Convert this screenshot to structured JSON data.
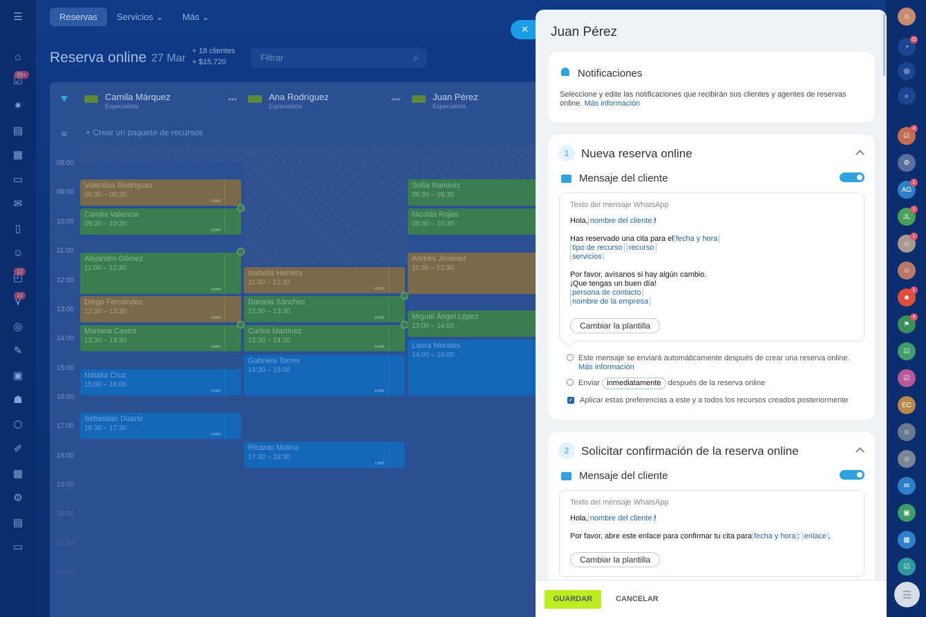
{
  "nav_left": {
    "badges": [
      "99+",
      "12",
      "14"
    ]
  },
  "topbar": {
    "tabs": [
      {
        "label": "Reservas"
      },
      {
        "label": "Servicios ⌄"
      },
      {
        "label": "Más ⌄"
      }
    ]
  },
  "header": {
    "title": "Reserva online",
    "date": "27 Mar",
    "clients": "+ 18 clientes",
    "revenue": "+ $15,720",
    "filter_placeholder": "Filtrar"
  },
  "calendar": {
    "columns": [
      {
        "name": "Camila Márquez",
        "role": "Especialista"
      },
      {
        "name": "Ana Rodríguez",
        "role": "Especialista"
      },
      {
        "name": "Juan Pérez",
        "role": "Especialista"
      }
    ],
    "create_package": "+ Crear un paquete de recursos",
    "hours": [
      "08:00",
      "09:00",
      "10:00",
      "11:00",
      "12:00",
      "13:00",
      "14:00",
      "15:00",
      "16:00",
      "17:00",
      "18:00",
      "19:00",
      "20:00",
      "21:00",
      "22:00"
    ],
    "events": [
      {
        "name": "Valentina Rodríguez",
        "time": "08:30 – 09:30",
        "crm": "CRM"
      },
      {
        "name": "Camila Valencia",
        "time": "09:30 – 10:30",
        "crm": "CRM"
      },
      {
        "name": "Alejandro Gómez",
        "time": "11:00 – 12:30",
        "crm": "CRM"
      },
      {
        "name": "Diego Fernández",
        "time": "12:30 – 13:30",
        "crm": "CRM"
      },
      {
        "name": "Mariana Castro",
        "time": "13:30 – 14:30",
        "crm": "CRM"
      },
      {
        "name": "Natalia Cruz",
        "time": "15:00 – 16:00",
        "crm": "CRM"
      },
      {
        "name": "Sebastián Duarte",
        "time": "16:30 – 17:30",
        "crm": "CRM"
      },
      {
        "name": "Isabella Herrera",
        "time": "11:30 – 12:30",
        "crm": "CRM"
      },
      {
        "name": "Daniela Sánchez",
        "time": "12:30 – 13:30",
        "crm": "CRM"
      },
      {
        "name": "Carlos Martínez",
        "time": "13:30 – 14:30",
        "crm": "CRM"
      },
      {
        "name": "Gabriela Torres",
        "time": "14:30 – 16:00",
        "crm": "CRM"
      },
      {
        "name": "Ricardo Molina",
        "time": "17:30 – 18:30",
        "crm": "CRM"
      },
      {
        "name": "Sofía Ramírez",
        "time": "08:30 – 09:30",
        "crm": ""
      },
      {
        "name": "Nicolás Rojas",
        "time": "09:30 – 10:30",
        "crm": ""
      },
      {
        "name": "Andrés Jiménez",
        "time": "11:00 – 12:30",
        "crm": ""
      },
      {
        "name": "Miguel Ángel López",
        "time": "13:00 – 14:00",
        "crm": ""
      },
      {
        "name": "Laura Morales",
        "time": "14:00 – 16:00",
        "crm": ""
      }
    ]
  },
  "panel": {
    "title": "Juan Pérez",
    "close": "✕",
    "notif": {
      "title": "Notificaciones",
      "desc": "Seleccione y edite las notificaciones que recibirán sus clientes y agentes de reservas online.",
      "link": "Más información"
    },
    "sec1": {
      "num": "1",
      "title": "Nueva reserva online",
      "msg_title": "Mensaje del cliente",
      "box_header": "Texto del mensaje WhatsApp",
      "hola": "Hola,",
      "tag_name": "nombre del cliente",
      "excl": "!",
      "l2a": "Has reservado una cita para el",
      "tag_fecha": "fecha y hora",
      "tag_tipo": "tipo de recurso",
      "tag_recurso": "recurso",
      "tag_serv": "servicios",
      "l4": "Por favor, avísanos si hay algún cambio.",
      "l5": "¡Que tengas un buen día!",
      "tag_persona": "persona de contacto",
      "tag_empresa": "nombre de la empresa",
      "tpl_btn": "Cambiar la plantilla",
      "info": "Este mensaje se enviará automáticamente después de crear una reserva online.",
      "info_link": "Más información",
      "send": "Enviar",
      "send_opt": "inmediatamente",
      "send_after": "después de la reserva online",
      "apply": "Aplicar estas preferencias a este y a todos los recursos creados posteriormente"
    },
    "sec2": {
      "num": "2",
      "title": "Solicitar confirmación de la reserva online",
      "msg_title": "Mensaje del cliente",
      "box_header": "Texto del mensaje WhatsApp",
      "hola": "Hola,",
      "tag_name": "nombre del cliente",
      "excl": "!",
      "l2a": "Por favor, abre este enlace para confirmar tu cita para",
      "tag_fecha": "fecha y hora",
      "colon": ": ",
      "tag_enlace": "enlace",
      "dot": ".",
      "tpl_btn": "Cambiar la plantilla"
    },
    "footer": {
      "save": "GUARDAR",
      "cancel": "CANCELAR"
    }
  },
  "rightbar": {
    "badges": [
      "11",
      "4",
      "1",
      "1",
      "1",
      "1",
      "4"
    ],
    "initials": [
      "AG",
      "JL",
      "EC"
    ]
  }
}
